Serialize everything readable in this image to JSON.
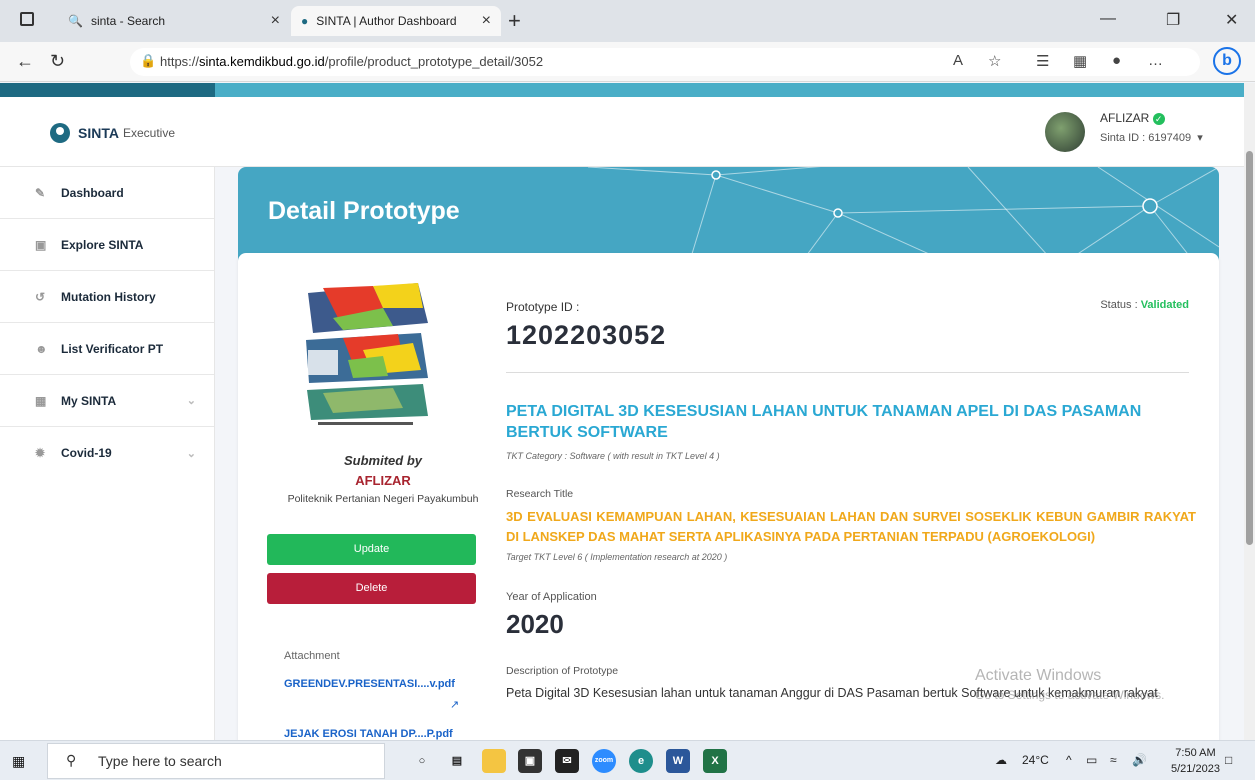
{
  "browser": {
    "tabs": [
      {
        "title": "sinta - Search",
        "active": false
      },
      {
        "title": "SINTA | Author Dashboard",
        "active": true
      }
    ],
    "url_prefix": "https://",
    "url_domain": "sinta.kemdikbud.go.id",
    "url_path": "/profile/product_prototype_detail/3052"
  },
  "header": {
    "logo_bold": "SINTA",
    "logo_sub": "Executive",
    "user_name": "AFLIZAR",
    "sinta_id": "Sinta ID : 6197409"
  },
  "sidebar": {
    "items": [
      {
        "label": "Dashboard",
        "icon": "pencil-icon"
      },
      {
        "label": "Explore SINTA",
        "icon": "book-icon"
      },
      {
        "label": "Mutation History",
        "icon": "history-icon"
      },
      {
        "label": "List Verificator PT",
        "icon": "user-icon"
      },
      {
        "label": "My SINTA",
        "icon": "grid-icon"
      },
      {
        "label": "Covid-19",
        "icon": "virus-icon"
      }
    ]
  },
  "main": {
    "page_title": "Detail Prototype",
    "submited_by": "Submited by",
    "author": "AFLIZAR",
    "institution": "Politeknik Pertanian Negeri Payakumbuh",
    "update_label": "Update",
    "delete_label": "Delete",
    "attachment_label": "Attachment",
    "attachments": [
      "GREENDEV.PRESENTASI....v.pdf",
      "JEJAK EROSI TANAH DP....P.pdf"
    ],
    "prototype_id_label": "Prototype ID :",
    "prototype_id": "1202203052",
    "status_label": "Status :",
    "status_value": "Validated",
    "prototype_title": "PETA DIGITAL 3D KESESUSIAN LAHAN UNTUK TANAMAN APEL DI DAS PASAMAN BERTUK SOFTWARE",
    "tkt_category": "TKT Category : Software ( with result in TKT Level  4 )",
    "research_title_label": "Research Title",
    "research_title": "3D EVALUASI KEMAMPUAN LAHAN, KESESUAIAN LAHAN DAN SURVEI SOSEKLIK KEBUN GAMBIR RAKYAT DI LANSKEP DAS MAHAT SERTA APLIKASINYA PADA PERTANIAN TERPADU (AGROEKOLOGI)",
    "target_tkt": "Target TKT Level 6 ( Implementation research at  2020 )",
    "year_label": "Year of Application",
    "year": "2020",
    "description_label": "Description of Prototype",
    "description": "Peta Digital 3D Kesesusian lahan untuk tanaman Anggur di DAS Pasaman bertuk Software untuk kemakmuran rakyat"
  },
  "watermark": {
    "line1": "Activate Windows",
    "line2": "Go to Settings to activate Windows."
  },
  "taskbar": {
    "search_placeholder": "Type here to search",
    "weather": "24°C",
    "time": "7:50 AM",
    "date": "5/21/2023"
  },
  "colors": {
    "accent": "#45a6c3",
    "validated": "#23bf5d",
    "update": "#22b85a",
    "delete": "#b81e3a",
    "research_title": "#f0a81b",
    "prototype_title": "#2aa8d3"
  }
}
